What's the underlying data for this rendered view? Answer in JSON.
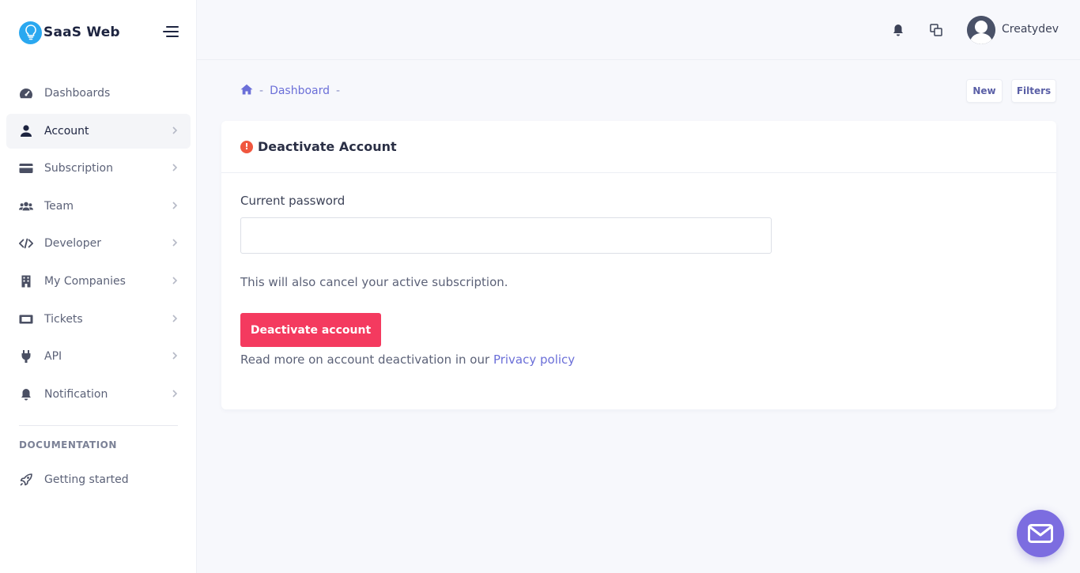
{
  "brand": {
    "name": "SaaS Web"
  },
  "sidebar": {
    "items": [
      {
        "label": "Dashboards",
        "icon": "dashboard-icon",
        "chevron": false,
        "active": false
      },
      {
        "label": "Account",
        "icon": "user-icon",
        "chevron": true,
        "active": true
      },
      {
        "label": "Subscription",
        "icon": "credit-card-icon",
        "chevron": true,
        "active": false
      },
      {
        "label": "Team",
        "icon": "users-icon",
        "chevron": true,
        "active": false
      },
      {
        "label": "Developer",
        "icon": "code-icon",
        "chevron": true,
        "active": false
      },
      {
        "label": "My Companies",
        "icon": "building-icon",
        "chevron": true,
        "active": false
      },
      {
        "label": "Tickets",
        "icon": "ticket-icon",
        "chevron": true,
        "active": false
      },
      {
        "label": "API",
        "icon": "plug-icon",
        "chevron": true,
        "active": false
      },
      {
        "label": "Notification",
        "icon": "bell-icon",
        "chevron": true,
        "active": false
      }
    ],
    "section_heading": "DOCUMENTATION",
    "doc_items": [
      {
        "label": "Getting started",
        "icon": "rocket-icon"
      }
    ]
  },
  "header": {
    "icons": [
      "bell-icon",
      "copy-icon"
    ],
    "username": "Creatydev"
  },
  "breadcrumb": {
    "items": [
      "Dashboard"
    ],
    "separator": "-"
  },
  "toolbar": {
    "new_label": "New",
    "filters_label": "Filters"
  },
  "card": {
    "title": "Deactivate Account",
    "field_label": "Current password",
    "password_value": "",
    "note": "This will also cancel your active subscription.",
    "button_label": "Deactivate account",
    "readmore_text": "Read more on account deactivation in our ",
    "readmore_link": "Privacy policy"
  },
  "colors": {
    "accent": "#6b6fd8",
    "danger": "#f43a5f",
    "warning": "#f0573f",
    "fab": "#7c6de0"
  }
}
